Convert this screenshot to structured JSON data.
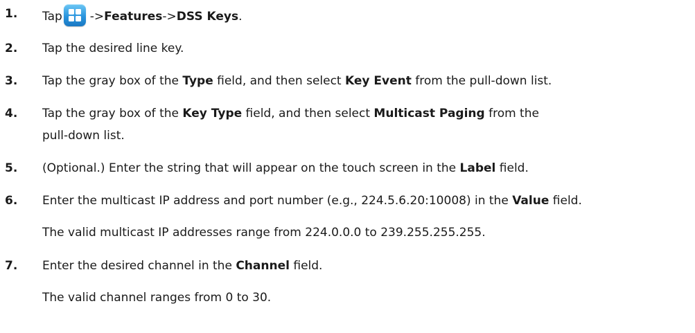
{
  "steps": [
    {
      "number": "1.",
      "parts": {
        "a": "Tap",
        "b": "->",
        "c": "Features",
        "d": "->",
        "e": "DSS Keys",
        "f": "."
      },
      "icon": "menu-grid-icon"
    },
    {
      "number": "2.",
      "text": "Tap the desired line key."
    },
    {
      "number": "3.",
      "parts": {
        "a": "Tap the gray box of the ",
        "b": "Type",
        "c": " field, and then select ",
        "d": "Key Event",
        "e": " from the pull-down list."
      }
    },
    {
      "number": "4.",
      "parts": {
        "a": "Tap the gray box of the ",
        "b": "Key Type",
        "c": " field, and then select ",
        "d": "Multicast Paging",
        "e": " from the"
      },
      "line2": "pull-down list."
    },
    {
      "number": "5.",
      "parts": {
        "a": "(Optional.) Enter the string that will appear on the touch screen in the ",
        "b": "Label",
        "c": " field."
      }
    },
    {
      "number": "6.",
      "parts": {
        "a": "Enter the multicast IP address and port number (e.g., 224.5.6.20:10008) in the ",
        "b": "Value",
        "c": " field."
      },
      "note": "The valid multicast IP addresses range from 224.0.0.0 to 239.255.255.255."
    },
    {
      "number": "7.",
      "parts": {
        "a": "Enter the desired channel in the ",
        "b": "Channel",
        "c": " field."
      },
      "note": "The valid channel ranges from 0 to 30."
    }
  ],
  "colors": {
    "text": "#1a1a1a",
    "icon_top": "#6ec8f5",
    "icon_bottom": "#1a78c2"
  }
}
